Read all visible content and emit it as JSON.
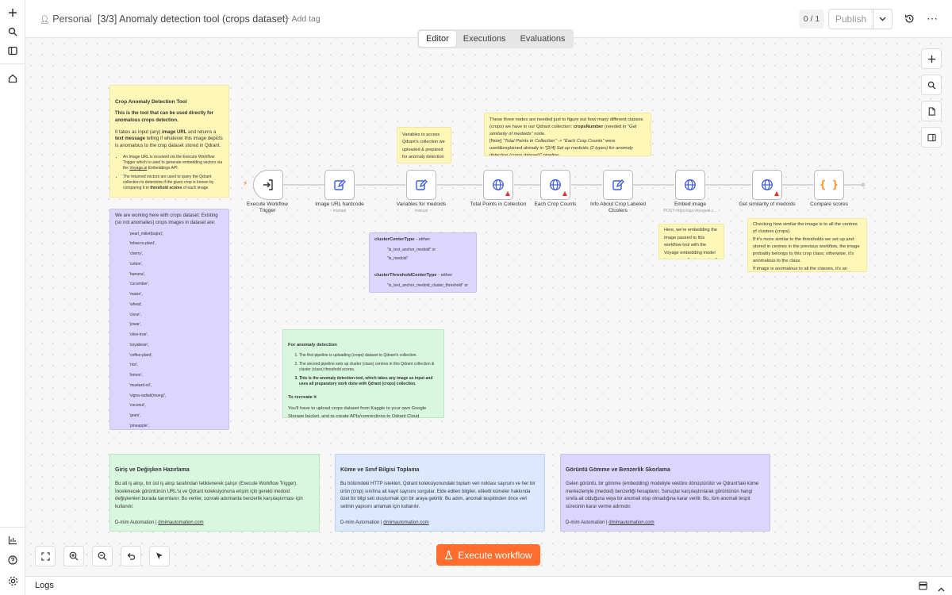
{
  "header": {
    "workspace": "Personal",
    "title": "[3/3] Anomaly detection tool (crops dataset)",
    "add_tag": "+ Add tag",
    "counter": "0 / 1",
    "publish": "Publish"
  },
  "tabs": [
    "Editor",
    "Executions",
    "Evaluations"
  ],
  "nodes": [
    {
      "label": "Execute Workflow\nTrigger",
      "sub": ""
    },
    {
      "label": "Image URL hardcode",
      "sub": "manual"
    },
    {
      "label": "Variables for medoids",
      "sub": "manual"
    },
    {
      "label": "Total Points in Collection",
      "sub": ""
    },
    {
      "label": "Each Crop Counts",
      "sub": ""
    },
    {
      "label": "Info About Crop Labeled\nClusters",
      "sub": ""
    },
    {
      "label": "Embed image",
      "sub": "POST: https://api.voyageai.c..."
    },
    {
      "label": "Get similarity of medoids",
      "sub": ""
    },
    {
      "label": "Compare scores",
      "sub": ""
    }
  ],
  "notes": {
    "tool": {
      "title": "Crop Anomaly Detection Tool",
      "bold": "This is the tool that can be used directly for anomalous crops detection.",
      "p1a": "It takes as input (any) ",
      "p1b": "image URL",
      "p1c": " and returns a ",
      "p1d": "text message",
      "p1e": " telling if whatever this image depicts is anomalous to the crop dataset stored in Qdrant.",
      "li1a": "An Image URL is received via the Execute Workflow Trigger which is used to generate embedding vectors via the ",
      "li1b": "Voyage.ai",
      "li1c": " Embeddings API.",
      "li2a": "The returned vectors are used to query the Qdrant collection to determine if the given crop is known by comparing it to ",
      "li2b": "threshold scores",
      "li2c": " of each image"
    },
    "crops": {
      "intro": "We are working here with crops dataset: Existing (so not anomalies) crops images in dataset are:",
      "items": [
        "'pearl_millet(bajra)',",
        "'tobacco-plant',",
        "'cherry',",
        "'cotton',",
        "'banana',",
        "'cucumber',",
        "'maize',",
        "'wheat',",
        "'clove',",
        "'jowar',",
        "'olive-tree',",
        "'soyabean',",
        "'coffee-plant',",
        "'rice',",
        "'lemon',",
        "'mustard-oil',",
        "'vigna-radiati(mung)',",
        "'coconut',",
        "'gram',",
        "'pineapple',",
        "'sugarcane',",
        "'sunflower',",
        "'chilli',",
        "'fox_nut(makhana)',",
        "'jute',"
      ]
    },
    "vars": {
      "text": "Variables to access Qdrant's collection we uploaded & prepared for anomaly detection"
    },
    "three": {
      "a": "These three nodes are needed just to figure out how many different classes (crops) we have in our Qdrant collection: ",
      "b": "cropsNumber",
      "c": " (needed in ",
      "d": "\"Get similarity of medoids\"",
      "e": " node.",
      "f": "[Note] ",
      "g": "\"Total Points in Collection\" -> \"Each Crop Counts\"",
      "h": " were used&explained already in ",
      "i": "\"[2/4] Set up medoids (2 types) for anomaly detection (crops dataset)\" pipeline."
    },
    "cluster": {
      "h1": "clusterCenterType",
      "h1s": " - either",
      "o1": "\"is_text_anchor_medoid\" or",
      "o2": "\"is_medoid\"",
      "h2": "clusterThresholdCenterType",
      "h2s": " - either",
      "o3": "\"is_text_anchor_medoid_cluster_threshold\" or"
    },
    "embed": {
      "text": "Here, we're embedding the image passed to this workflow tool with the Voyage embedding model to compare the image to all"
    },
    "check": {
      "p1": "Checking how similar the image is to all the centres of clusters (crops).",
      "p2": "If it's more similar to the thresholds we set up and stored in centres in the previous workflow, the image probably belongs to this crop class; otherwise, it's anomalous to the class.",
      "p3": "If image is anomalous to all the classes, it's an"
    },
    "anomaly": {
      "title": "For anomaly detection",
      "items": [
        "The first pipeline is uploading (crops) dataset to Qdrant's collection.",
        "The second pipeline sets up cluster (class) centres in this Qdrant collection & cluster (class) threshold scores.",
        "This is the anomaly detection tool, which takes any image as input and uses all preparatory work done with Qdrant (crops) collection."
      ],
      "title2": "To recreate it",
      "p1": "You'll have to upload crops dataset from Kaggle to your own Google Storage bucket, and re-create APIs/connections to Qdrant Cloud"
    },
    "tr1": {
      "title": "Giriş ve Değişken Hazırlama",
      "body": "Bu alt iş akışı, bir üst iş akışı tarafından tetiklenerek çalışır (Execute Workflow Trigger). İncelenecek görüntünün URL'si ve Qdrant koleksiyonuna erişim için gerekli medoid değişkenleri burada tanımlanır. Bu veriler, sonraki adımlarda benzerlik karşılaştırması için kullanılır.",
      "foot": "D-mim Automation | ",
      "link": "dmimautomation.com"
    },
    "tr2": {
      "title": "Küme ve Sınıf Bilgisi Toplama",
      "body": "Bu bölümdeki HTTP istekleri, Qdrant koleksiyonundaki toplam veri noktası sayısını ve her bir ürün (crop) sınıfına ait kayıt sayısını sorgular. Elde edilen bilgiler, etiketli kümeler hakkında özet bir bilgi seti oluşturmak için bir araya getirilir. Bu adım, anomali tespitinden önce veri setinin yapısını anlamak için kullanılır.",
      "foot": "D-mim Automation | ",
      "link": "dmimautomation.com"
    },
    "tr3": {
      "title": "Görüntü Gömme ve Benzerlik Skorlama",
      "body": "Gelen görüntü, bir gömme (embedding) modeliyle vektöre dönüştürülür ve Qdrant'taki küme merkezleriyle (medoid) benzerliği hesaplanır. Sonuçlar karşılaştırılarak görüntünün hangi sınıfa ait olduğuna veya bir anomali olup olmadığına karar verilir. Bu, tüm anomali tespit sürecinin karar verme adımıdır.",
      "foot": "D-mim Automation | ",
      "link": "dmimautomation.com"
    }
  },
  "footer": {
    "execute": "Execute workflow",
    "logs": "Logs"
  }
}
